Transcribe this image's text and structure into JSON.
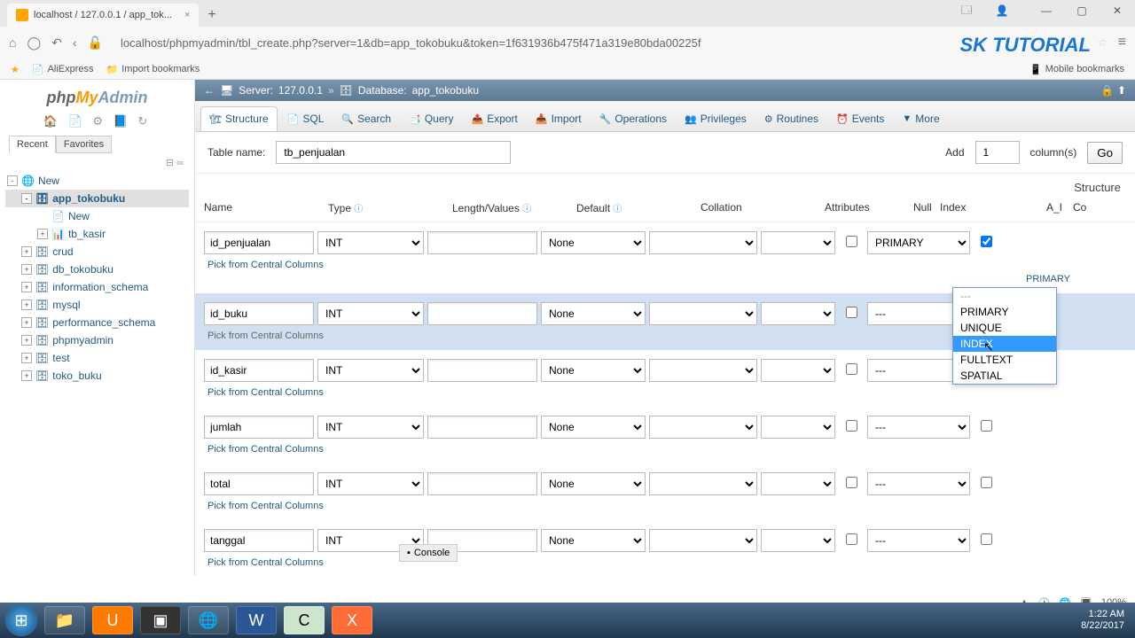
{
  "browser": {
    "tab_title": "localhost / 127.0.0.1 / app_tok...",
    "new_tab": "+",
    "url": "localhost/phpmyadmin/tbl_create.php?server=1&db=app_tokobuku&token=1f631936b475f471a319e80bda00225f",
    "bookmarks": {
      "aliexpress": "AliExpress",
      "import": "Import bookmarks",
      "mobile": "Mobile bookmarks"
    },
    "tutorial_logo": {
      "sk": "SK ",
      "tut": "TUTORIAL"
    }
  },
  "sidebar": {
    "logo": {
      "php": "php",
      "my": "My",
      "admin": "Admin"
    },
    "tabs": {
      "recent": "Recent",
      "favorites": "Favorites"
    },
    "tree": {
      "new": "New",
      "app_tokobuku": "app_tokobuku",
      "app_new": "New",
      "tb_kasir": "tb_kasir",
      "crud": "crud",
      "db_tokobuku": "db_tokobuku",
      "information_schema": "information_schema",
      "mysql": "mysql",
      "performance_schema": "performance_schema",
      "phpmyadmin": "phpmyadmin",
      "test": "test",
      "toko_buku": "toko_buku"
    }
  },
  "breadcrumb": {
    "server_label": "Server:",
    "server": "127.0.0.1",
    "db_label": "Database:",
    "db": "app_tokobuku"
  },
  "tabs": {
    "structure": "Structure",
    "sql": "SQL",
    "search": "Search",
    "query": "Query",
    "export": "Export",
    "import": "Import",
    "operations": "Operations",
    "privileges": "Privileges",
    "routines": "Routines",
    "events": "Events",
    "more": "More"
  },
  "form": {
    "table_name_label": "Table name:",
    "table_name": "tb_penjualan",
    "add_label": "Add",
    "add_count": "1",
    "columns_label": "column(s)",
    "go": "Go"
  },
  "structure_label": "Structure",
  "headers": {
    "name": "Name",
    "type": "Type",
    "length": "Length/Values",
    "default": "Default",
    "collation": "Collation",
    "attributes": "Attributes",
    "null": "Null",
    "index": "Index",
    "ai": "A_I",
    "co": "Co"
  },
  "pick_link": "Pick from Central Columns",
  "rows": [
    {
      "name": "id_penjualan",
      "type": "INT",
      "default": "None",
      "index": "PRIMARY",
      "index_sub": "PRIMARY",
      "ai": true
    },
    {
      "name": "id_buku",
      "type": "INT",
      "default": "None",
      "index": "---",
      "highlight": true
    },
    {
      "name": "id_kasir",
      "type": "INT",
      "default": "None",
      "index": "---"
    },
    {
      "name": "jumlah",
      "type": "INT",
      "default": "None",
      "index": "---"
    },
    {
      "name": "total",
      "type": "INT",
      "default": "None",
      "index": "---"
    },
    {
      "name": "tanggal",
      "type": "INT",
      "default": "None",
      "index": "---"
    }
  ],
  "dropdown": {
    "options": [
      "---",
      "PRIMARY",
      "UNIQUE",
      "INDEX",
      "FULLTEXT",
      "SPATIAL"
    ],
    "selected": "INDEX"
  },
  "console": "Console",
  "systray": {
    "zoom": "100%"
  },
  "clock": {
    "time": "1:22 AM",
    "date": "8/22/2017"
  }
}
